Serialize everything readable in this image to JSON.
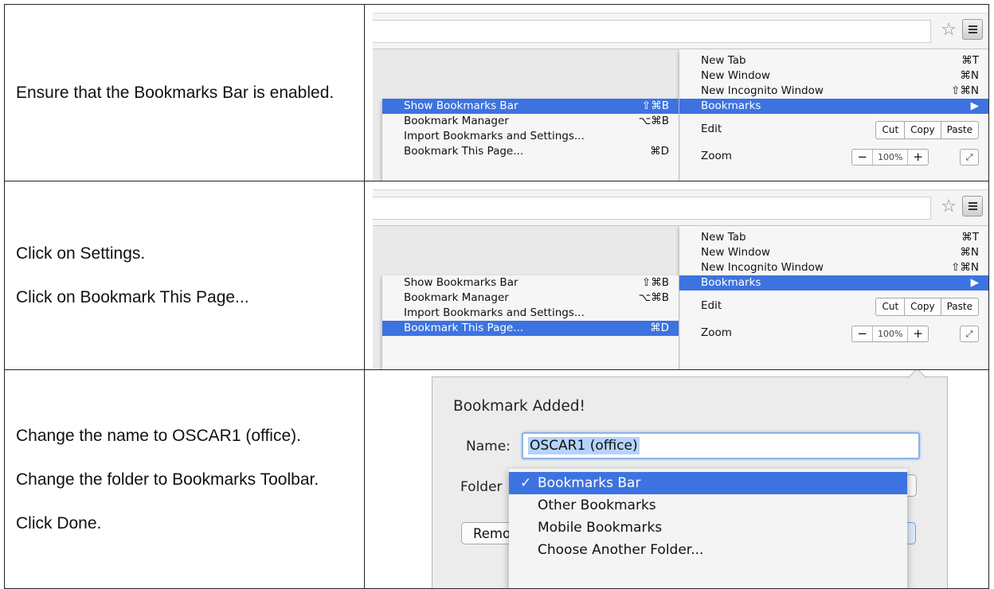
{
  "rows": [
    {
      "instructions": [
        "Ensure that the Bookmarks Bar is enabled."
      ],
      "highlighted_submenu_index": 0
    },
    {
      "instructions": [
        "Click on Settings.",
        "Click on Bookmark This Page..."
      ],
      "highlighted_submenu_index": 3
    },
    {
      "instructions": [
        "Change the name to OSCAR1 (office).",
        "Change the folder to Bookmarks Toolbar.",
        "Click Done."
      ]
    }
  ],
  "chrome_menu": {
    "items": [
      {
        "label": "New Tab",
        "shortcut": "⌘T"
      },
      {
        "label": "New Window",
        "shortcut": "⌘N"
      },
      {
        "label": "New Incognito Window",
        "shortcut": "⇧⌘N"
      },
      {
        "label": "Bookmarks",
        "shortcut": "▶"
      }
    ],
    "edit": {
      "label": "Edit",
      "cut": "Cut",
      "copy": "Copy",
      "paste": "Paste"
    },
    "zoom": {
      "label": "Zoom",
      "minus": "−",
      "value": "100%",
      "plus": "+",
      "fullscreen": "⤢"
    }
  },
  "bookmarks_submenu": {
    "items": [
      {
        "label": "Show Bookmarks Bar",
        "shortcut": "⇧⌘B"
      },
      {
        "label": "Bookmark Manager",
        "shortcut": "⌥⌘B"
      },
      {
        "label": "Import Bookmarks and Settings...",
        "shortcut": ""
      },
      {
        "label": "Bookmark This Page...",
        "shortcut": "⌘D"
      }
    ]
  },
  "dialog": {
    "title": "Bookmark Added!",
    "name_label": "Name:",
    "name_value": "OSCAR1 (office)",
    "folder_label": "Folder",
    "remove_label": "Remove",
    "folder_options": [
      {
        "label": "Bookmarks Bar",
        "checked": true,
        "check": "✓"
      },
      {
        "label": "Other Bookmarks",
        "checked": false
      },
      {
        "label": "Mobile Bookmarks",
        "checked": false
      },
      {
        "label": "Choose Another Folder...",
        "checked": false
      }
    ]
  },
  "icons": {
    "star": "star-outline-icon",
    "menu": "hamburger-menu-icon"
  },
  "colors": {
    "menu_highlight": "#3d73e0",
    "input_focus": "#8db3e6",
    "selection": "#b5d3fd"
  }
}
